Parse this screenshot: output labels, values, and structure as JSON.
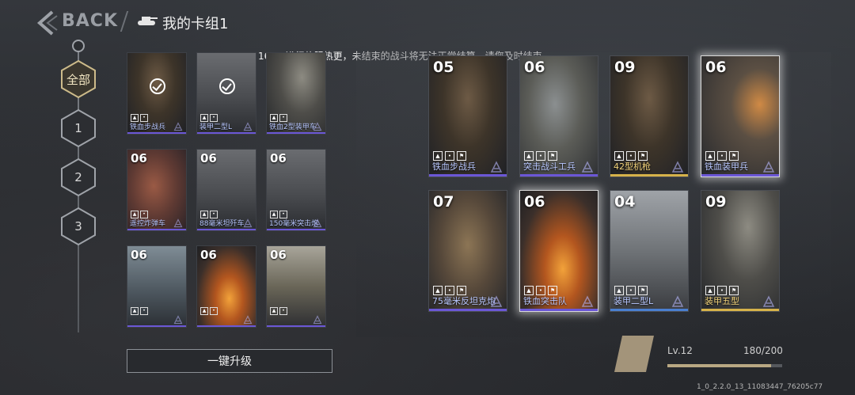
{
  "header": {
    "back_label": "BACK",
    "deck_title": "我的卡组1"
  },
  "notice": "16:00进行停服热更，未结束的战斗将无法正常结算，请您及时结束。",
  "filters": [
    {
      "label": "全部",
      "selected": true
    },
    {
      "label": "1",
      "selected": false
    },
    {
      "label": "2",
      "selected": false
    },
    {
      "label": "3",
      "selected": false
    }
  ],
  "collection": [
    {
      "cost": "",
      "name": "铁血步战兵",
      "in_deck": true,
      "palette": "soldier"
    },
    {
      "cost": "",
      "name": "装甲二型L",
      "in_deck": true,
      "palette": "tank-gray"
    },
    {
      "cost": "",
      "name": "铁血2型装甲车",
      "in_deck": false,
      "palette": "tank-war"
    },
    {
      "cost": "06",
      "name": "遥控炸弹车",
      "in_deck": false,
      "palette": "blueprint"
    },
    {
      "cost": "06",
      "name": "88毫米坦歼车",
      "in_deck": false,
      "palette": "tank-gray"
    },
    {
      "cost": "06",
      "name": "150毫米突击炮",
      "in_deck": false,
      "palette": "tank-gray"
    },
    {
      "cost": "06",
      "name": "",
      "in_deck": false,
      "palette": "tank-cold"
    },
    {
      "cost": "06",
      "name": "",
      "in_deck": false,
      "palette": "fire"
    },
    {
      "cost": "06",
      "name": "",
      "in_deck": false,
      "palette": "soldier-sky"
    }
  ],
  "deck": [
    {
      "cost": "05",
      "name": "铁血步战兵",
      "rarity": "purple",
      "glow": false,
      "palette": "soldier"
    },
    {
      "cost": "06",
      "name": "突击战斗工兵",
      "rarity": "purple",
      "glow": false,
      "palette": "soldier-light"
    },
    {
      "cost": "09",
      "name": "42型机枪",
      "rarity": "gold",
      "glow": false,
      "palette": "soldier"
    },
    {
      "cost": "06",
      "name": "铁血装甲兵",
      "rarity": "purple",
      "glow": true,
      "palette": "soldier-fire"
    },
    {
      "cost": "07",
      "name": "75毫米反坦克炮",
      "rarity": "purple",
      "glow": false,
      "palette": "gun-brown"
    },
    {
      "cost": "06",
      "name": "铁血突击队",
      "rarity": "purple",
      "glow": true,
      "palette": "fire"
    },
    {
      "cost": "04",
      "name": "装甲二型L",
      "rarity": "blue",
      "glow": false,
      "palette": "tank-light"
    },
    {
      "cost": "09",
      "name": "装甲五型",
      "rarity": "gold",
      "glow": false,
      "palette": "tank-war"
    }
  ],
  "colors": {
    "purple": "#6b57d6",
    "blue": "#4a7fd0",
    "gold": "#d6b24a",
    "name_purple": "#b9c8ff",
    "name_gold": "#f1d27a"
  },
  "upgrade_button": "一键升级",
  "level": {
    "label": "Lv.12",
    "progress_text": "180/200",
    "progress_fraction": 0.9
  },
  "build": "1_0_2.2.0_13_11083447_76205c77"
}
